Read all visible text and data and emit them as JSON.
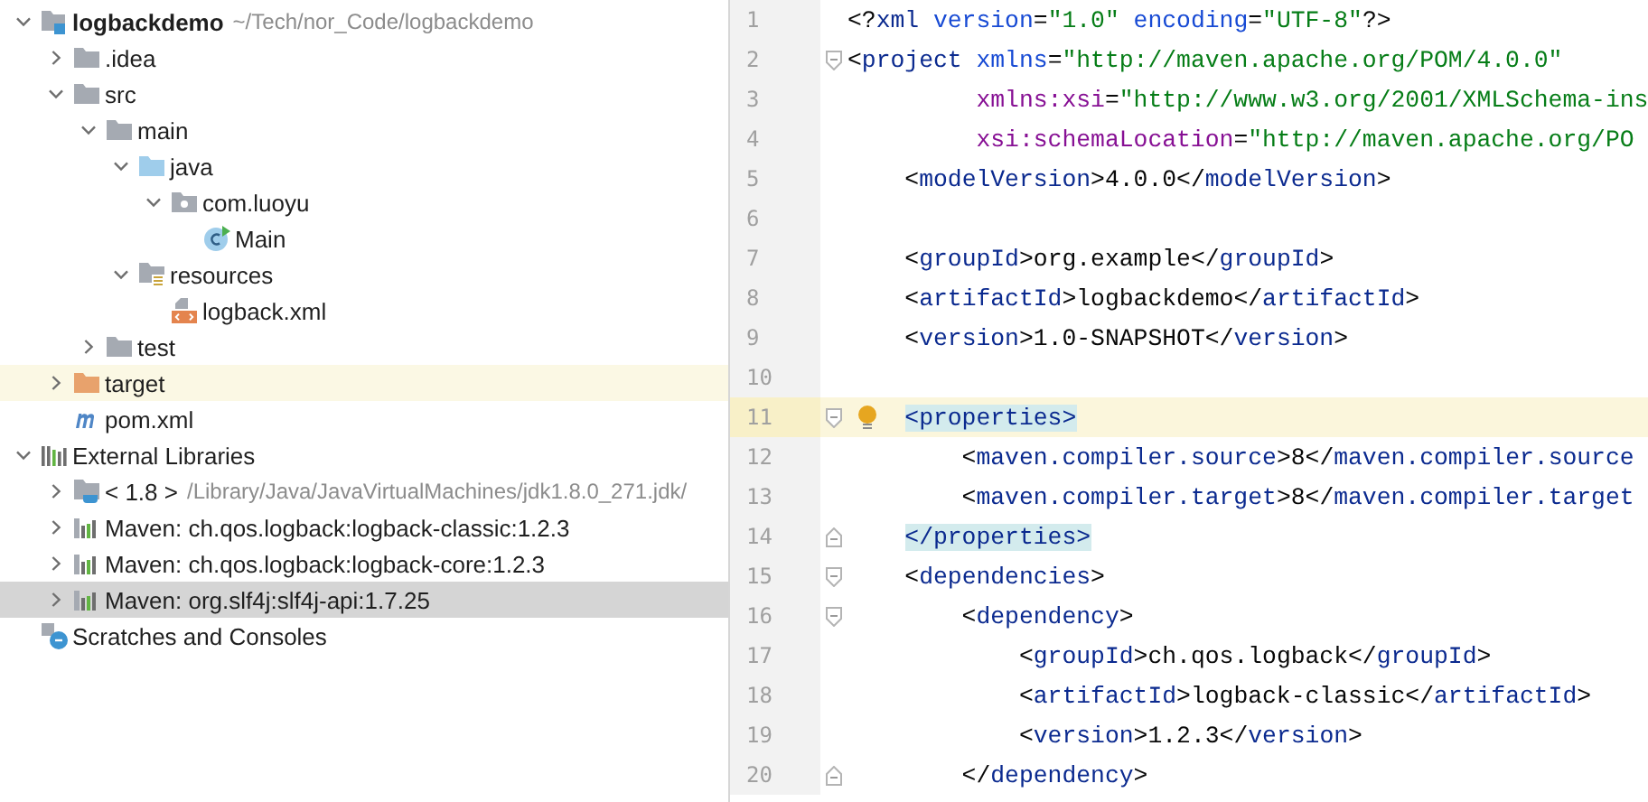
{
  "project_tree": [
    {
      "label": "logbackdemo",
      "hint": "~/Tech/nor_Code/logbackdemo",
      "kind": "module",
      "expanded": true,
      "selected": false,
      "highlighted": false,
      "children": [
        {
          "label": ".idea",
          "kind": "folder",
          "expanded": false,
          "selected": false,
          "highlighted": false
        },
        {
          "label": "src",
          "kind": "folder",
          "expanded": true,
          "selected": false,
          "highlighted": false,
          "children": [
            {
              "label": "main",
              "kind": "folder",
              "expanded": true,
              "selected": false,
              "highlighted": false,
              "children": [
                {
                  "label": "java",
                  "kind": "source-folder",
                  "expanded": true,
                  "selected": false,
                  "highlighted": false,
                  "children": [
                    {
                      "label": "com.luoyu",
                      "kind": "package",
                      "expanded": true,
                      "selected": false,
                      "highlighted": false,
                      "children": [
                        {
                          "label": "Main",
                          "kind": "class",
                          "selected": false,
                          "highlighted": false
                        }
                      ]
                    }
                  ]
                },
                {
                  "label": "resources",
                  "kind": "resources",
                  "expanded": true,
                  "selected": false,
                  "highlighted": false,
                  "children": [
                    {
                      "label": "logback.xml",
                      "kind": "xml",
                      "selected": false,
                      "highlighted": false
                    }
                  ]
                }
              ]
            },
            {
              "label": "test",
              "kind": "folder",
              "expanded": false,
              "selected": false,
              "highlighted": false
            }
          ]
        },
        {
          "label": "target",
          "kind": "excluded-folder",
          "expanded": false,
          "selected": false,
          "highlighted": true
        },
        {
          "label": "pom.xml",
          "kind": "maven",
          "selected": false,
          "highlighted": false
        }
      ]
    },
    {
      "label": "External Libraries",
      "kind": "libraries",
      "expanded": true,
      "selected": false,
      "highlighted": false,
      "children": [
        {
          "label": "< 1.8 >",
          "hint": "/Library/Java/JavaVirtualMachines/jdk1.8.0_271.jdk/",
          "kind": "jdk",
          "expanded": false,
          "selected": false,
          "highlighted": false
        },
        {
          "label": "Maven: ch.qos.logback:logback-classic:1.2.3",
          "kind": "library",
          "expanded": false,
          "selected": false,
          "highlighted": false
        },
        {
          "label": "Maven: ch.qos.logback:logback-core:1.2.3",
          "kind": "library",
          "expanded": false,
          "selected": false,
          "highlighted": false
        },
        {
          "label": "Maven: org.slf4j:slf4j-api:1.7.25",
          "kind": "library",
          "expanded": false,
          "selected": true,
          "highlighted": false
        }
      ]
    },
    {
      "label": "Scratches and Consoles",
      "kind": "scratches",
      "selected": false,
      "highlighted": false
    }
  ],
  "editor": {
    "lines": [
      {
        "number": "1",
        "current": false,
        "intention": false,
        "fold_open": false,
        "fold_close": false,
        "tokens": [
          {
            "kind": "punct",
            "text": "<?"
          },
          {
            "kind": "tag",
            "text": "xml "
          },
          {
            "kind": "attr",
            "text": "version"
          },
          {
            "kind": "punct",
            "text": "="
          },
          {
            "kind": "value",
            "text": "\"1.0\" "
          },
          {
            "kind": "attr",
            "text": "encoding"
          },
          {
            "kind": "punct",
            "text": "="
          },
          {
            "kind": "value",
            "text": "\"UTF-8\""
          },
          {
            "kind": "punct",
            "text": "?>"
          }
        ]
      },
      {
        "number": "2",
        "current": false,
        "intention": false,
        "fold_open": true,
        "fold_close": false,
        "tokens": [
          {
            "kind": "punct",
            "text": "<"
          },
          {
            "kind": "tag",
            "text": "project "
          },
          {
            "kind": "attr",
            "text": "xmlns"
          },
          {
            "kind": "punct",
            "text": "="
          },
          {
            "kind": "value",
            "text": "\"http://maven.apache.org/POM/4.0.0\""
          }
        ]
      },
      {
        "number": "3",
        "current": false,
        "intention": false,
        "fold_open": false,
        "fold_close": false,
        "tokens": [
          {
            "kind": "ns",
            "text": "         xmlns:xsi"
          },
          {
            "kind": "punct",
            "text": "="
          },
          {
            "kind": "value",
            "text": "\"http://www.w3.org/2001/XMLSchema-ins"
          }
        ]
      },
      {
        "number": "4",
        "current": false,
        "intention": false,
        "fold_open": false,
        "fold_close": false,
        "tokens": [
          {
            "kind": "ns",
            "text": "         xsi:schemaLocation"
          },
          {
            "kind": "punct",
            "text": "="
          },
          {
            "kind": "value",
            "text": "\"http://maven.apache.org/PO"
          }
        ]
      },
      {
        "number": "5",
        "current": false,
        "intention": false,
        "fold_open": false,
        "fold_close": false,
        "tokens": [
          {
            "kind": "punct",
            "text": "    <"
          },
          {
            "kind": "tag",
            "text": "modelVersion"
          },
          {
            "kind": "punct",
            "text": ">"
          },
          {
            "kind": "text",
            "text": "4.0.0"
          },
          {
            "kind": "punct",
            "text": "</"
          },
          {
            "kind": "tag",
            "text": "modelVersion"
          },
          {
            "kind": "punct",
            "text": ">"
          }
        ]
      },
      {
        "number": "6",
        "current": false,
        "intention": false,
        "fold_open": false,
        "fold_close": false
      },
      {
        "number": "7",
        "current": false,
        "intention": false,
        "fold_open": false,
        "fold_close": false,
        "tokens": [
          {
            "kind": "punct",
            "text": "    <"
          },
          {
            "kind": "tag",
            "text": "groupId"
          },
          {
            "kind": "punct",
            "text": ">"
          },
          {
            "kind": "text",
            "text": "org.example"
          },
          {
            "kind": "punct",
            "text": "</"
          },
          {
            "kind": "tag",
            "text": "groupId"
          },
          {
            "kind": "punct",
            "text": ">"
          }
        ]
      },
      {
        "number": "8",
        "current": false,
        "intention": false,
        "fold_open": false,
        "fold_close": false,
        "tokens": [
          {
            "kind": "punct",
            "text": "    <"
          },
          {
            "kind": "tag",
            "text": "artifactId"
          },
          {
            "kind": "punct",
            "text": ">"
          },
          {
            "kind": "text",
            "text": "logbackdemo"
          },
          {
            "kind": "punct",
            "text": "</"
          },
          {
            "kind": "tag",
            "text": "artifactId"
          },
          {
            "kind": "punct",
            "text": ">"
          }
        ]
      },
      {
        "number": "9",
        "current": false,
        "intention": false,
        "fold_open": false,
        "fold_close": false,
        "tokens": [
          {
            "kind": "punct",
            "text": "    <"
          },
          {
            "kind": "tag",
            "text": "version"
          },
          {
            "kind": "punct",
            "text": ">"
          },
          {
            "kind": "text",
            "text": "1.0-SNAPSHOT"
          },
          {
            "kind": "punct",
            "text": "</"
          },
          {
            "kind": "tag",
            "text": "version"
          },
          {
            "kind": "punct",
            "text": ">"
          }
        ]
      },
      {
        "number": "10",
        "current": false,
        "intention": false,
        "fold_open": false,
        "fold_close": false
      },
      {
        "number": "11",
        "current": true,
        "intention": true,
        "fold_open": true,
        "fold_close": false,
        "tokens": [
          {
            "kind": "match",
            "text": "    <properties>"
          }
        ]
      },
      {
        "number": "12",
        "current": false,
        "intention": false,
        "fold_open": false,
        "fold_close": false,
        "tokens": [
          {
            "kind": "punct",
            "text": "        <"
          },
          {
            "kind": "tag",
            "text": "maven.compiler.source"
          },
          {
            "kind": "punct",
            "text": ">"
          },
          {
            "kind": "text",
            "text": "8"
          },
          {
            "kind": "punct",
            "text": "</"
          },
          {
            "kind": "tag",
            "text": "maven.compiler.source"
          }
        ]
      },
      {
        "number": "13",
        "current": false,
        "intention": false,
        "fold_open": false,
        "fold_close": false,
        "tokens": [
          {
            "kind": "punct",
            "text": "        <"
          },
          {
            "kind": "tag",
            "text": "maven.compiler.target"
          },
          {
            "kind": "punct",
            "text": ">"
          },
          {
            "kind": "text",
            "text": "8"
          },
          {
            "kind": "punct",
            "text": "</"
          },
          {
            "kind": "tag",
            "text": "maven.compiler.target"
          }
        ]
      },
      {
        "number": "14",
        "current": false,
        "intention": false,
        "fold_open": false,
        "fold_close": true,
        "tokens": [
          {
            "kind": "match",
            "text": "    </properties>"
          }
        ]
      },
      {
        "number": "15",
        "current": false,
        "intention": false,
        "fold_open": true,
        "fold_close": false,
        "tokens": [
          {
            "kind": "punct",
            "text": "    <"
          },
          {
            "kind": "tag",
            "text": "dependencies"
          },
          {
            "kind": "punct",
            "text": ">"
          }
        ]
      },
      {
        "number": "16",
        "current": false,
        "intention": false,
        "fold_open": true,
        "fold_close": false,
        "tokens": [
          {
            "kind": "punct",
            "text": "        <"
          },
          {
            "kind": "tag",
            "text": "dependency"
          },
          {
            "kind": "punct",
            "text": ">"
          }
        ]
      },
      {
        "number": "17",
        "current": false,
        "intention": false,
        "fold_open": false,
        "fold_close": false,
        "tokens": [
          {
            "kind": "punct",
            "text": "            <"
          },
          {
            "kind": "tag",
            "text": "groupId"
          },
          {
            "kind": "punct",
            "text": ">"
          },
          {
            "kind": "text",
            "text": "ch.qos.logback"
          },
          {
            "kind": "punct",
            "text": "</"
          },
          {
            "kind": "tag",
            "text": "groupId"
          },
          {
            "kind": "punct",
            "text": ">"
          }
        ]
      },
      {
        "number": "18",
        "current": false,
        "intention": false,
        "fold_open": false,
        "fold_close": false,
        "tokens": [
          {
            "kind": "punct",
            "text": "            <"
          },
          {
            "kind": "tag",
            "text": "artifactId"
          },
          {
            "kind": "punct",
            "text": ">"
          },
          {
            "kind": "text",
            "text": "logback-classic"
          },
          {
            "kind": "punct",
            "text": "</"
          },
          {
            "kind": "tag",
            "text": "artifactId"
          },
          {
            "kind": "punct",
            "text": ">"
          }
        ]
      },
      {
        "number": "19",
        "current": false,
        "intention": false,
        "fold_open": false,
        "fold_close": false,
        "tokens": [
          {
            "kind": "punct",
            "text": "            <"
          },
          {
            "kind": "tag",
            "text": "version"
          },
          {
            "kind": "punct",
            "text": ">"
          },
          {
            "kind": "text",
            "text": "1.2.3"
          },
          {
            "kind": "punct",
            "text": "</"
          },
          {
            "kind": "tag",
            "text": "version"
          },
          {
            "kind": "punct",
            "text": ">"
          }
        ]
      },
      {
        "number": "20",
        "current": false,
        "intention": false,
        "fold_open": false,
        "fold_close": true,
        "tokens": [
          {
            "kind": "punct",
            "text": "        </"
          },
          {
            "kind": "tag",
            "text": "dependency"
          },
          {
            "kind": "punct",
            "text": ">"
          }
        ]
      }
    ]
  }
}
